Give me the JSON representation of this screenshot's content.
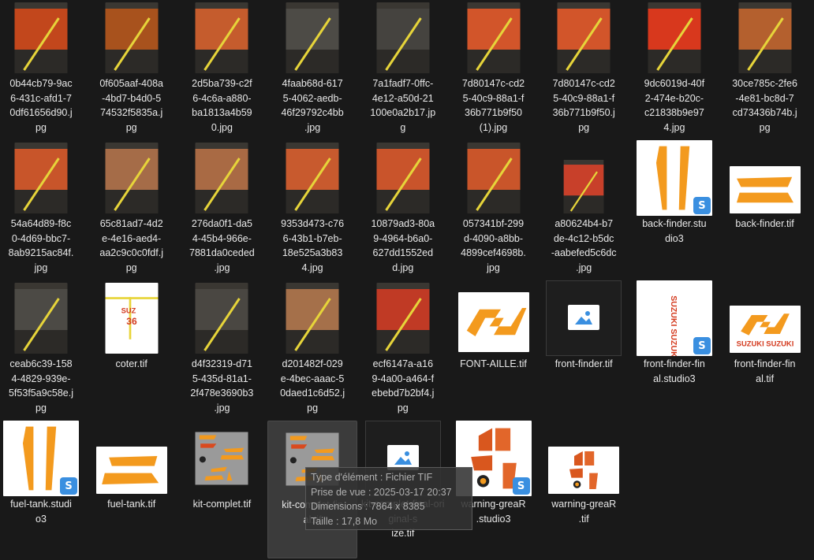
{
  "colors": {
    "background": "#191919",
    "selected": "#3b3b3b",
    "accent": "#3a8fe0",
    "orange": "#f39a1e"
  },
  "files": [
    {
      "name": "0b44cb79-9ac6-431c-afd1-70df61656d90.jpg",
      "type": "photo",
      "tone": "#c2471c"
    },
    {
      "name": "0f605aaf-408a-4bd7-b4d0-574532f5835a.jpg",
      "type": "photo",
      "tone": "#a8521d"
    },
    {
      "name": "2d5ba739-c2f6-4c6a-a880-ba1813a4b590.jpg",
      "type": "photo",
      "tone": "#c55c2d"
    },
    {
      "name": "4faab68d-6175-4062-aedb-46f29792c4bb.jpg",
      "type": "photo",
      "tone": "#4d4b46"
    },
    {
      "name": "7a1fadf7-0ffc-4e12-a50d-21100e0a2b17.jpg",
      "type": "photo",
      "tone": "#45433f"
    },
    {
      "name": "7d80147c-cd25-40c9-88a1-f36b771b9f50 (1).jpg",
      "type": "photo",
      "tone": "#d2552a"
    },
    {
      "name": "7d80147c-cd25-40c9-88a1-f36b771b9f50.jpg",
      "type": "photo",
      "tone": "#d2552a"
    },
    {
      "name": "9dc6019d-40f2-474e-b20c-c21838b9e974.jpg",
      "type": "photo",
      "tone": "#d8381d"
    },
    {
      "name": "30ce785c-2fe6-4e81-bc8d-7cd73436b74b.jpg",
      "type": "photo",
      "tone": "#b4602e"
    },
    {
      "name": "54a64d89-f8c0-4d69-bbc7-8ab9215ac84f.jpg",
      "type": "photo",
      "tone": "#c8552a"
    },
    {
      "name": "65c81ad7-4d2e-4e16-aed4-aa2c9c0c0fdf.jpg",
      "type": "photo",
      "tone": "#a56c48"
    },
    {
      "name": "276da0f1-da54-45b4-966e-7881da0ceded.jpg",
      "type": "photo",
      "tone": "#a96a44"
    },
    {
      "name": "9353d473-c766-43b1-b7eb-18e525a3b834.jpg",
      "type": "photo",
      "tone": "#c85a2e"
    },
    {
      "name": "10879ad3-80a9-4964-b6a0-627dd1552edd.jpg",
      "type": "photo",
      "tone": "#c9542b"
    },
    {
      "name": "057341bf-299d-4090-a8bb-4899cef4698b.jpg",
      "type": "photo",
      "tone": "#c9552a"
    },
    {
      "name": "a80624b4-b7de-4c12-b5dc-aabefed5c6dc.jpg",
      "type": "photo-wide",
      "tone": "#c8402a"
    },
    {
      "name": "back-finder.studio3",
      "type": "studio",
      "art": "vbars"
    },
    {
      "name": "back-finder.tif",
      "type": "art-wide",
      "art": "hbars"
    },
    {
      "name": "ceab6c39-1584-4829-939e-5f53f5a9c58e.jpg",
      "type": "photo",
      "tone": "#4c4a45"
    },
    {
      "name": "coter.tif",
      "type": "photo",
      "tone": "#ffffff",
      "art": "coter"
    },
    {
      "name": "d4f32319-d715-435d-81a1-2f478e3690b3.jpg",
      "type": "photo",
      "tone": "#4a4742"
    },
    {
      "name": "d201482f-029e-4bec-aaac-50daed1c6d52.jpg",
      "type": "photo",
      "tone": "#a5704a"
    },
    {
      "name": "ecf6147a-a169-4a00-a464-febebd7b2bf4.jpg",
      "type": "photo",
      "tone": "#c03a25"
    },
    {
      "name": "FONT-AILLE.tif",
      "type": "art-mid",
      "art": "zigzag"
    },
    {
      "name": "front-finder.tif",
      "type": "placeholder"
    },
    {
      "name": "front-finder-final.studio3",
      "type": "studio",
      "art": "suzuki-v"
    },
    {
      "name": "front-finder-final.tif",
      "type": "art-mid2",
      "art": "suzuki"
    },
    {
      "name": "fuel-tank.studio3",
      "type": "studio",
      "art": "vbars"
    },
    {
      "name": "fuel-tank.tif",
      "type": "art-wide",
      "art": "fuelbars"
    },
    {
      "name": "kit-complet.tif",
      "type": "art-kit",
      "art": "kit"
    },
    {
      "name": "kit-complet-final.tif",
      "type": "art-kit",
      "art": "kit",
      "selected": true
    },
    {
      "name": "kit-complet-final-original-size.tif",
      "type": "placeholder"
    },
    {
      "name": "warning-greaR.studio3",
      "type": "studio",
      "art": "warning"
    },
    {
      "name": "warning-greaR.tif",
      "type": "art-wide",
      "art": "warning"
    }
  ],
  "labels": [
    "0b44cb79-9ac\n6-431c-afd1-7\n0df61656d90.j\npg",
    "0f605aaf-408a\n-4bd7-b4d0-5\n74532f5835a.j\npg",
    "2d5ba739-c2f\n6-4c6a-a880-\nba1813a4b59\n0.jpg",
    "4faab68d-617\n5-4062-aedb-\n46f29792c4bb\n.jpg",
    "7a1fadf7-0ffc-\n4e12-a50d-21\n100e0a2b17.jp\ng",
    "7d80147c-cd2\n5-40c9-88a1-f\n36b771b9f50\n(1).jpg",
    "7d80147c-cd2\n5-40c9-88a1-f\n36b771b9f50.j\npg",
    "9dc6019d-40f\n2-474e-b20c-\nc21838b9e97\n4.jpg",
    "30ce785c-2fe6\n-4e81-bc8d-7\ncd73436b74b.j\npg",
    "54a64d89-f8c\n0-4d69-bbc7-\n8ab9215ac84f.\njpg",
    "65c81ad7-4d2\ne-4e16-aed4-\naa2c9c0c0fdf.j\npg",
    "276da0f1-da5\n4-45b4-966e-\n7881da0ceded\n.jpg",
    "9353d473-c76\n6-43b1-b7eb-\n18e525a3b83\n4.jpg",
    "10879ad3-80a\n9-4964-b6a0-\n627dd1552ed\nd.jpg",
    "057341bf-299\nd-4090-a8bb-\n4899cef4698b.\njpg",
    "a80624b4-b7\nde-4c12-b5dc\n-aabefed5c6dc\n.jpg",
    "back-finder.stu\ndio3",
    "back-finder.tif",
    "ceab6c39-158\n4-4829-939e-\n5f53f5a9c58e.j\npg",
    "coter.tif",
    "d4f32319-d71\n5-435d-81a1-\n2f478e3690b3\n.jpg",
    "d201482f-029\ne-4bec-aaac-5\n0daed1c6d52.j\npg",
    "ecf6147a-a16\n9-4a00-a464-f\nebebd7b2bf4.j\npg",
    "FONT-AILLE.tif",
    "front-finder.tif",
    "front-finder-fin\nal.studio3",
    "front-finder-fin\nal.tif",
    "fuel-tank.studi\no3",
    "fuel-tank.tif",
    "kit-complet.tif",
    "kit-complet-fin\nal.tif",
    "kit-complet-final-original-s\nize.tif",
    "warning-greaR\n.studio3",
    "warning-greaR\n.tif"
  ],
  "tooltip": {
    "type": "Type d'élément : Fichier TIF",
    "date": "Prise de vue : 2025-03-17 20:37",
    "dims": "Dimensions : 7864 x 8385",
    "size": "Taille : 17,8 Mo"
  }
}
